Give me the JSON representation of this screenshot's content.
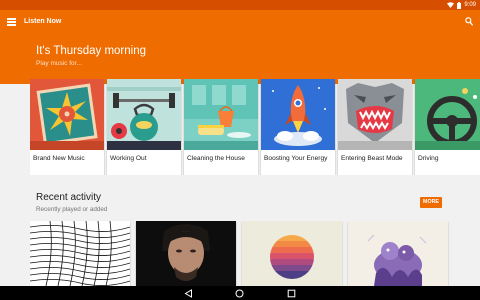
{
  "status_bar": {
    "time": "9:09",
    "wifi_icon": "wifi-icon",
    "battery_icon": "battery-icon"
  },
  "app_bar": {
    "title": "Listen Now",
    "menu_icon": "hamburger-menu-icon",
    "search_icon": "search-icon"
  },
  "hero": {
    "title": "It's Thursday morning",
    "subtitle": "Play music for..."
  },
  "activities": [
    {
      "label": "Brand New Music",
      "art_icon": "vinyl-starburst-icon"
    },
    {
      "label": "Working Out",
      "art_icon": "kettlebell-weights-icon"
    },
    {
      "label": "Cleaning the House",
      "art_icon": "bucket-sponge-icon"
    },
    {
      "label": "Boosting Your Energy",
      "art_icon": "rocket-icon"
    },
    {
      "label": "Entering Beast Mode",
      "art_icon": "beast-face-icon"
    },
    {
      "label": "Driving",
      "art_icon": "steering-wheel-icon"
    }
  ],
  "recent": {
    "title": "Recent activity",
    "subtitle": "Recently played or added",
    "more_label": "MORE",
    "albums": [
      {
        "art_icon": "wave-lines-art"
      },
      {
        "art_icon": "portrait-photo-art"
      },
      {
        "art_icon": "sunset-stripes-art"
      },
      {
        "art_icon": "purple-figure-art"
      }
    ]
  },
  "nav_bar": {
    "back_icon": "back-icon",
    "home_icon": "home-icon",
    "recents_icon": "recents-icon"
  },
  "colors": {
    "primary": "#ef6c00",
    "status_bar": "#d64f00",
    "background": "#f1f1f1"
  }
}
